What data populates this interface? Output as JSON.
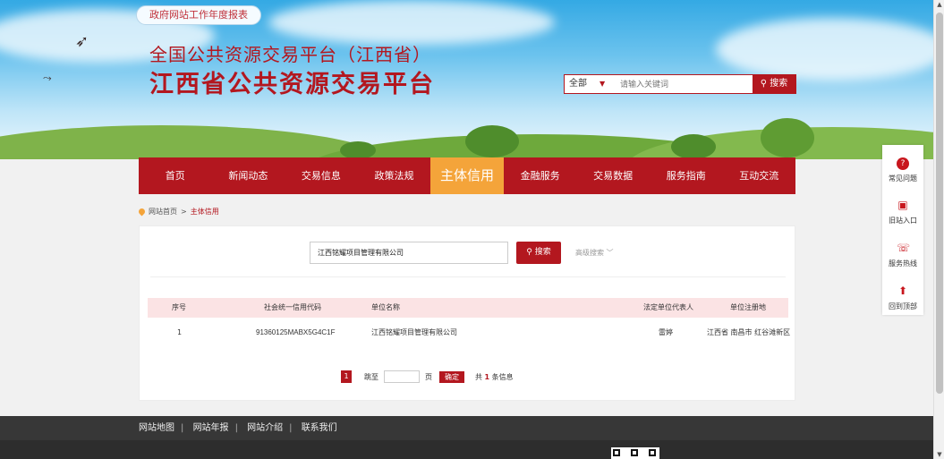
{
  "header": {
    "report_link": "政府网站工作年度报表",
    "title_line1": "全国公共资源交易平台（江西省）",
    "title_line2": "江西省公共资源交易平台",
    "search": {
      "scope": "全部",
      "placeholder": "请输入关键词",
      "button": "搜索"
    }
  },
  "nav": {
    "items": [
      {
        "label": "首页"
      },
      {
        "label": "新闻动态"
      },
      {
        "label": "交易信息"
      },
      {
        "label": "政策法规"
      },
      {
        "label": "主体信用"
      },
      {
        "label": "金融服务"
      },
      {
        "label": "交易数据"
      },
      {
        "label": "服务指南"
      },
      {
        "label": "互动交流"
      }
    ],
    "active": "主体信用"
  },
  "side_toolbar": {
    "items": [
      {
        "label": "常见问题",
        "icon": "question-icon"
      },
      {
        "label": "旧站入口",
        "icon": "old-site-icon"
      },
      {
        "label": "服务热线",
        "icon": "phone-icon"
      },
      {
        "label": "回到顶部",
        "icon": "back-to-top-icon"
      }
    ]
  },
  "breadcrumb": {
    "home": "网站首页",
    "separator": ">",
    "current": "主体信用"
  },
  "query": {
    "value": "江西铭耀项目管理有限公司",
    "button": "搜索",
    "advanced": "高级搜索"
  },
  "table": {
    "headers": [
      "序号",
      "社会统一信用代码",
      "单位名称",
      "法定单位代表人",
      "单位注册地"
    ],
    "rows": [
      [
        "1",
        "91360125MABX5G4C1F",
        "江西铭耀项目管理有限公司",
        "雷婷",
        "江西省 南昌市 红谷滩新区"
      ]
    ]
  },
  "pager": {
    "current": "1",
    "jump_label": "跳至",
    "page_unit": "页",
    "confirm": "确定",
    "total_prefix": "共",
    "total_count": "1",
    "total_suffix": "条信息"
  },
  "footer": {
    "links": [
      "网站地图",
      "网站年报",
      "网站介绍",
      "联系我们"
    ]
  },
  "colors": {
    "brand_red": "#b3171f",
    "active_orange": "#f4a43a"
  }
}
